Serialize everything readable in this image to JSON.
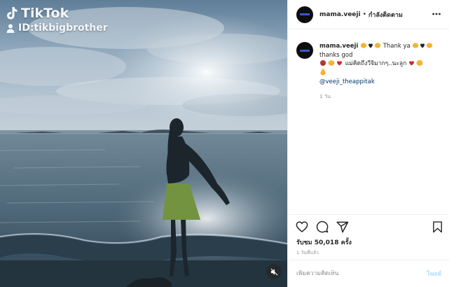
{
  "media": {
    "watermark_brand": "TikTok",
    "watermark_id": "ID:tikbigbrother",
    "mute_icon": "speaker-muted-icon"
  },
  "post_header": {
    "username": "mama.veeji",
    "separator": "•",
    "follow_status": "กำลังติดตาม",
    "more_icon": "more-options-icon"
  },
  "caption": {
    "username": "mama.veeji",
    "line1_text": "Thank ya",
    "line2_text": "thanks god",
    "line3_text": "แม่คิดถึงวีจิมากๆ..นะลูก",
    "mention": "@veeji_theappitak",
    "time": "1 วัน"
  },
  "actions": {
    "like_icon": "heart-icon",
    "comment_icon": "comment-icon",
    "share_icon": "share-icon",
    "save_icon": "bookmark-icon"
  },
  "stats": {
    "views": "รับชม 50,018 ครั้ง",
    "posted": "1 วันที่แล้ว"
  },
  "comment_box": {
    "placeholder": "เพิ่มความคิดเห็น",
    "post_label": "โพสต์"
  },
  "colors": {
    "text": "#262626",
    "muted": "#8e8e8e",
    "link": "#00376b",
    "post_disabled": "#b2dffc",
    "divider": "#efefef"
  }
}
